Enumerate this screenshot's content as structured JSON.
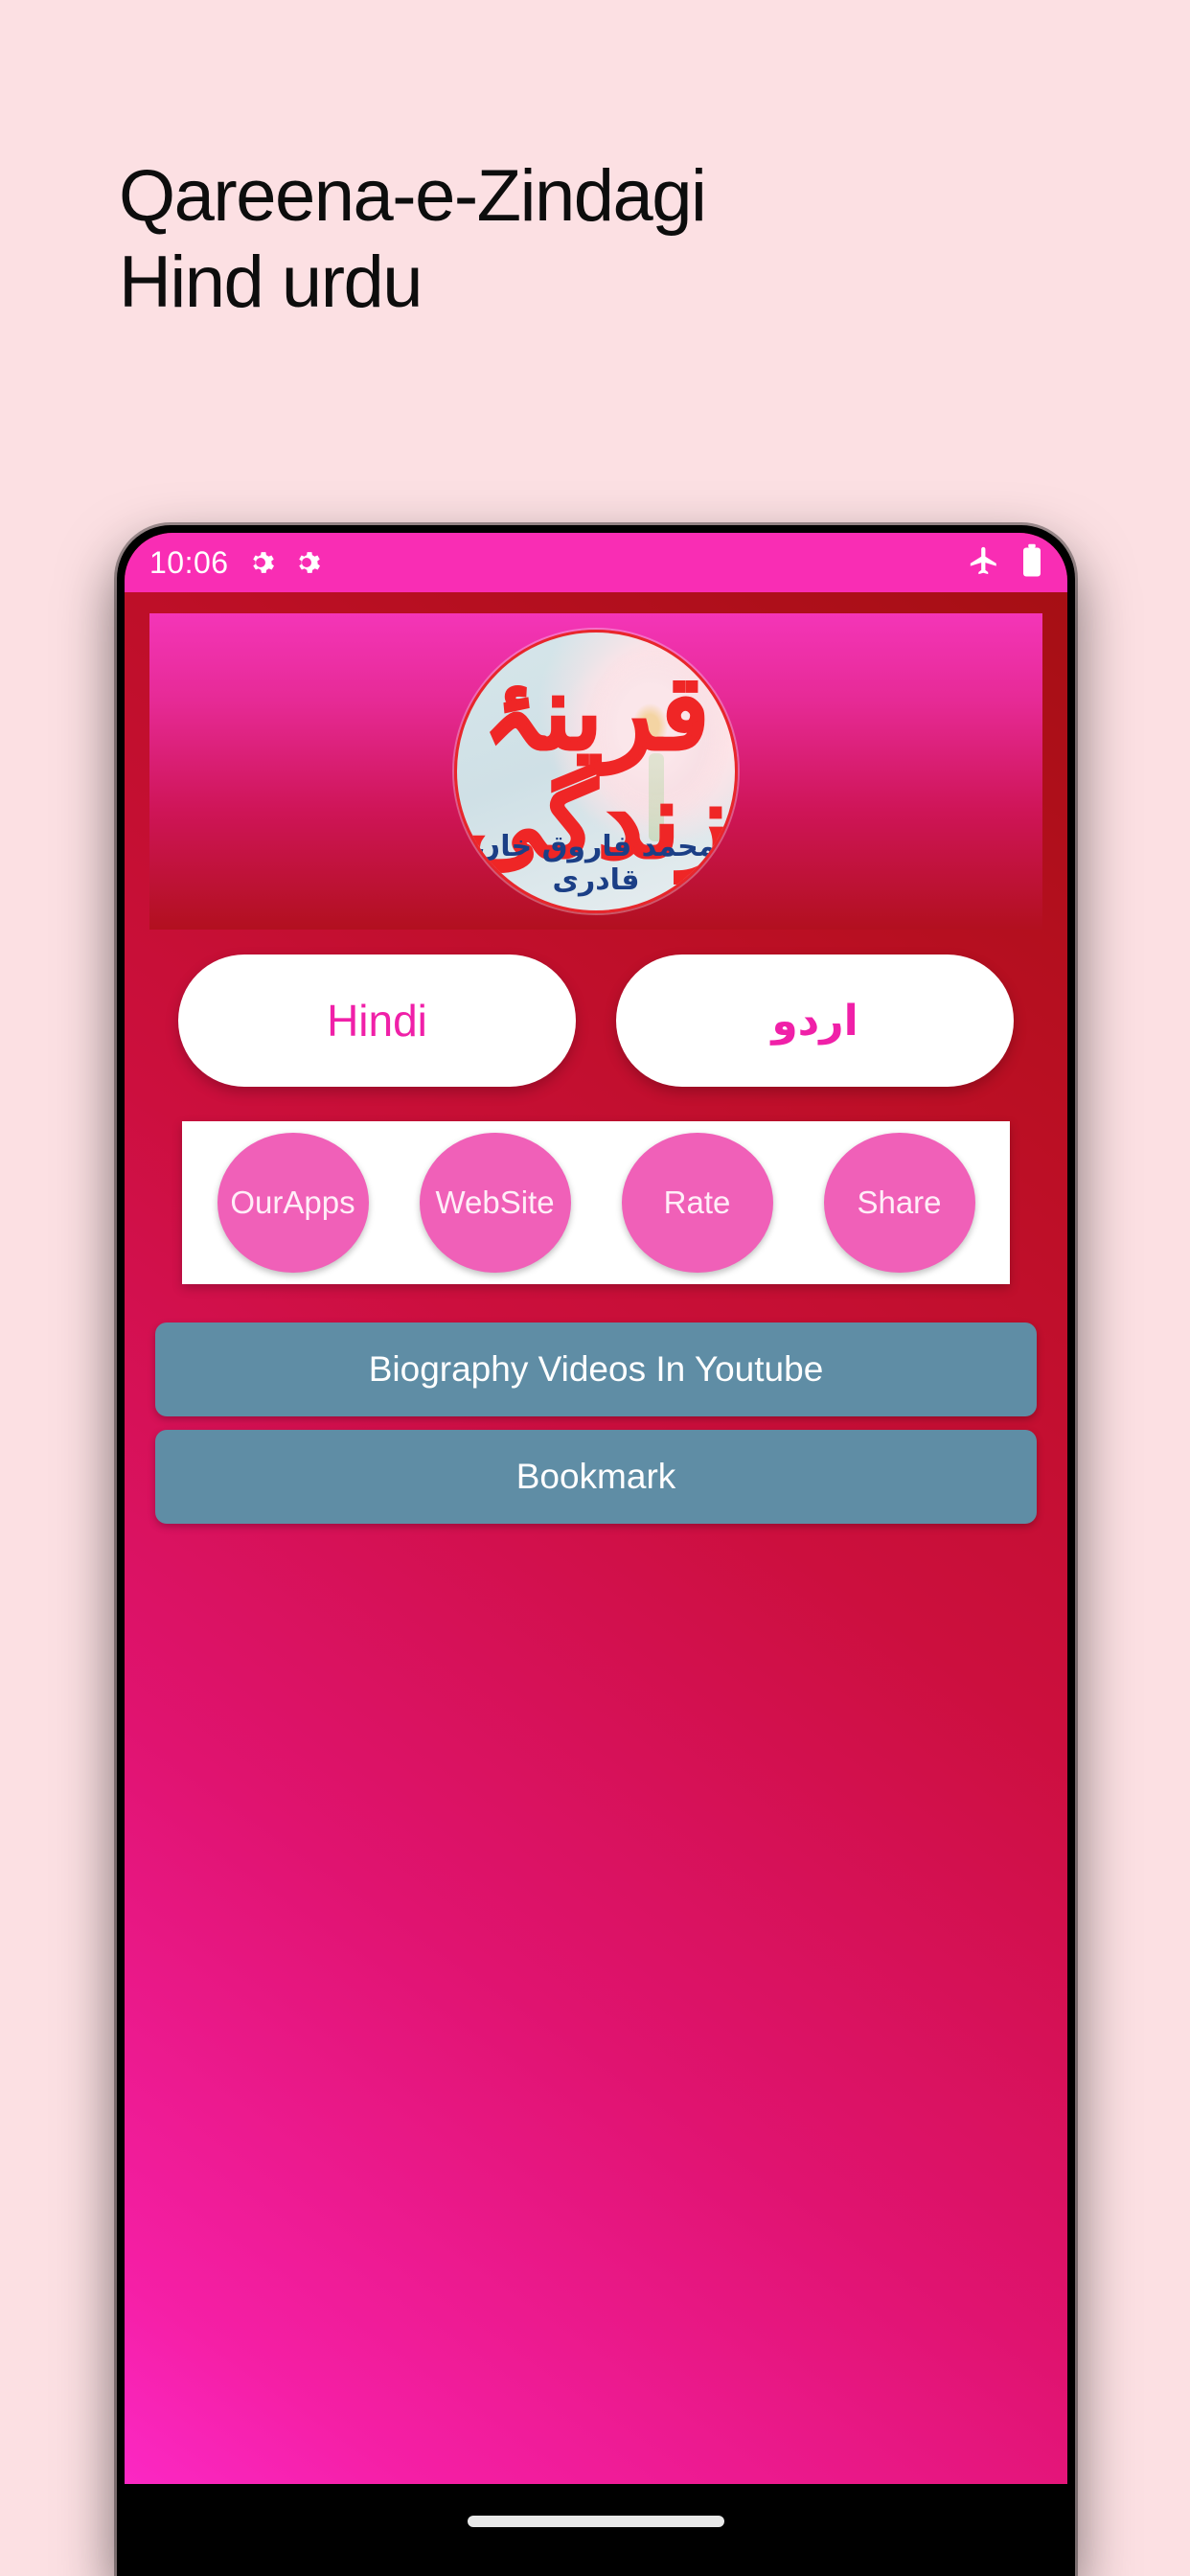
{
  "listing": {
    "title": "Qareena-e-Zindagi\nHind urdu",
    "background_color": "#fce0e3"
  },
  "phone": {
    "status_bar": {
      "clock": "10:06",
      "left_icons": [
        "gear-icon",
        "gear-icon"
      ],
      "right_icons": [
        "airplane-mode-icon",
        "battery-icon"
      ],
      "background_color": "#f92db4",
      "text_color": "#ffffff"
    },
    "app": {
      "banner": {
        "logo_title_urdu": "قرینۂ زندگی",
        "logo_author_urdu": "محمد فاروق خاں قادری",
        "gradient_from": "#f435b8",
        "gradient_to": "#b2101f"
      },
      "language_buttons": [
        {
          "label": "Hindi",
          "script": "latin"
        },
        {
          "label": "اردو",
          "script": "urdu"
        }
      ],
      "action_buttons": [
        {
          "label": "OurApps"
        },
        {
          "label": "WebSite"
        },
        {
          "label": "Rate"
        },
        {
          "label": "Share"
        }
      ],
      "list_buttons": [
        {
          "label": "Biography Videos In Youtube"
        },
        {
          "label": "Bookmark"
        }
      ],
      "accent_colors": {
        "magenta": "#f020a8",
        "pink_oval": "#f060b8",
        "steel_blue": "#5f8da5",
        "deep_red": "#b3101d"
      }
    },
    "nav_bar": {
      "home_indicator": true,
      "background_color": "#000000"
    }
  }
}
